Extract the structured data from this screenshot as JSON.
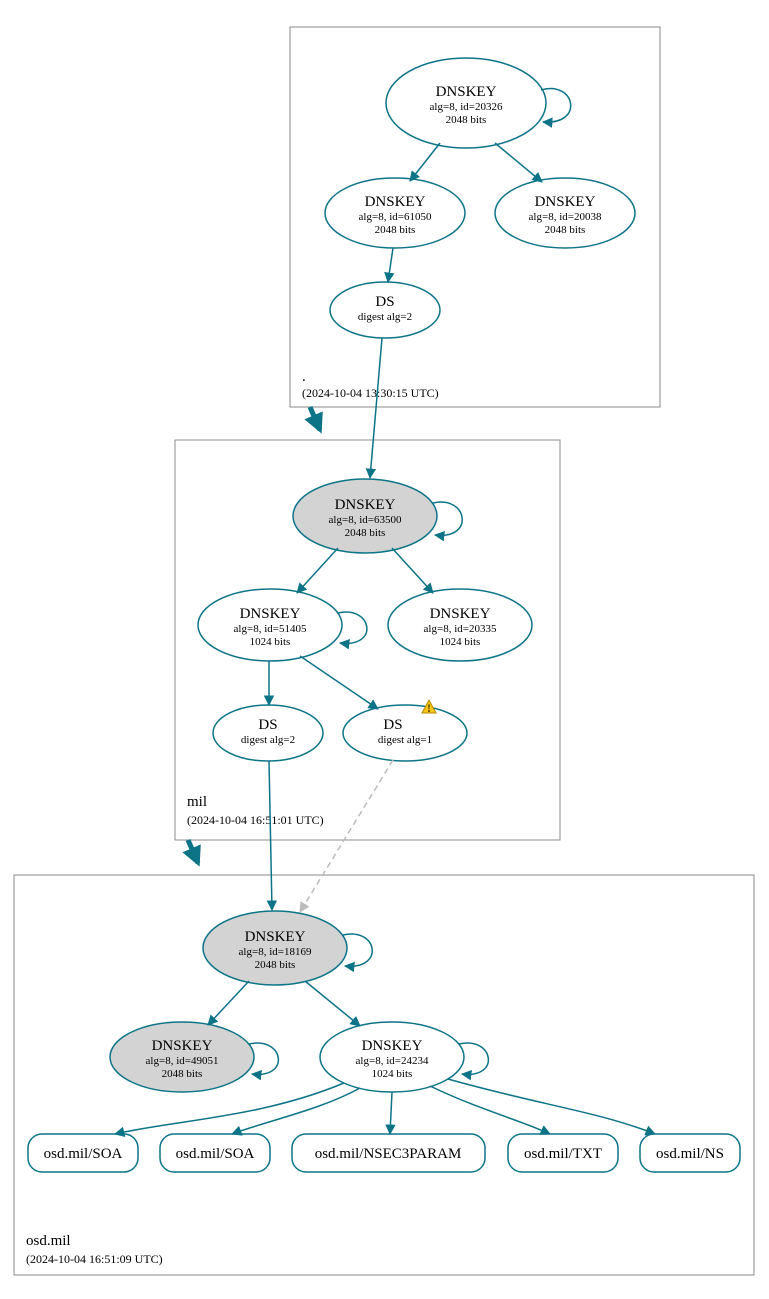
{
  "zones": {
    "root": {
      "name": ".",
      "time": "(2024-10-04 13:30:15 UTC)"
    },
    "mil": {
      "name": "mil",
      "time": "(2024-10-04 16:51:01 UTC)"
    },
    "osd": {
      "name": "osd.mil",
      "time": "(2024-10-04 16:51:09 UTC)"
    }
  },
  "nodes": {
    "root_ksk": {
      "title": "DNSKEY",
      "line1": "alg=8, id=20326",
      "line2": "2048 bits"
    },
    "root_zsk1": {
      "title": "DNSKEY",
      "line1": "alg=8, id=61050",
      "line2": "2048 bits"
    },
    "root_zsk2": {
      "title": "DNSKEY",
      "line1": "alg=8, id=20038",
      "line2": "2048 bits"
    },
    "root_ds": {
      "title": "DS",
      "line1": "digest alg=2"
    },
    "mil_ksk": {
      "title": "DNSKEY",
      "line1": "alg=8, id=63500",
      "line2": "2048 bits"
    },
    "mil_zsk1": {
      "title": "DNSKEY",
      "line1": "alg=8, id=51405",
      "line2": "1024 bits"
    },
    "mil_zsk2": {
      "title": "DNSKEY",
      "line1": "alg=8, id=20335",
      "line2": "1024 bits"
    },
    "mil_ds1": {
      "title": "DS",
      "line1": "digest alg=2"
    },
    "mil_ds2": {
      "title": "DS",
      "line1": "digest alg=1"
    },
    "osd_ksk": {
      "title": "DNSKEY",
      "line1": "alg=8, id=18169",
      "line2": "2048 bits"
    },
    "osd_key2": {
      "title": "DNSKEY",
      "line1": "alg=8, id=49051",
      "line2": "2048 bits"
    },
    "osd_zsk": {
      "title": "DNSKEY",
      "line1": "alg=8, id=24234",
      "line2": "1024 bits"
    }
  },
  "rr": {
    "soa1": "osd.mil/SOA",
    "soa2": "osd.mil/SOA",
    "nsec": "osd.mil/NSEC3PARAM",
    "txt": "osd.mil/TXT",
    "ns": "osd.mil/NS"
  }
}
